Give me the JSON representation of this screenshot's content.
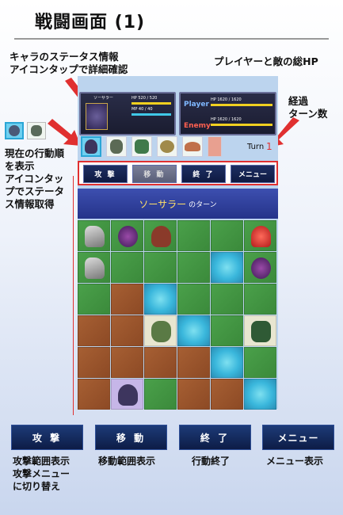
{
  "page": {
    "title": "戦闘画面 (1)"
  },
  "annotations": {
    "status_info": "キャラのステータス情報\nアイコンタップで詳細確認",
    "total_hp": "プレイヤーと敵の総HP",
    "turn_count": "経過\nターン数",
    "action_order": "現在の行動順\nを表示\nアイコンタッ\nプでステータ\nス情報取得"
  },
  "status_panel": {
    "name": "ソーサラー",
    "hp_label": "HP 520 / 520",
    "mp_label": "MP 40 / 40",
    "hp_ratio": 1.0,
    "mp_ratio": 1.0
  },
  "total_panel": {
    "player_label": "Player",
    "player_hp": "HP 1620 / 1620",
    "enemy_label": "Enemy",
    "enemy_hp": "HP 1620 / 1620",
    "player_ratio": 1.0,
    "enemy_ratio": 1.0
  },
  "turn": {
    "label": "Turn",
    "value": "1"
  },
  "action_order": [
    "sorcerer",
    "knight",
    "golem",
    "bird",
    "bat",
    "bat2"
  ],
  "game_buttons": [
    {
      "label": "攻 撃",
      "enabled": true
    },
    {
      "label": "移 動",
      "enabled": false
    },
    {
      "label": "終 了",
      "enabled": true
    },
    {
      "label": "メニュー",
      "enabled": true
    }
  ],
  "turn_banner": {
    "name": "ソーサラー",
    "suffix": "のターン"
  },
  "bottom_buttons": [
    {
      "label": "攻 撃",
      "caption": "攻撃範囲表示\n攻撃メニュー\nに切り替え"
    },
    {
      "label": "移 動",
      "caption": "移動範囲表示"
    },
    {
      "label": "終 了",
      "caption": "行動終了"
    },
    {
      "label": "メニュー",
      "caption": "メニュー表示"
    }
  ],
  "colors": {
    "accent_red": "#e03030",
    "banner_yellow": "#ffe066",
    "hp_yellow": "#f0d020",
    "mp_blue": "#40c8e8"
  }
}
